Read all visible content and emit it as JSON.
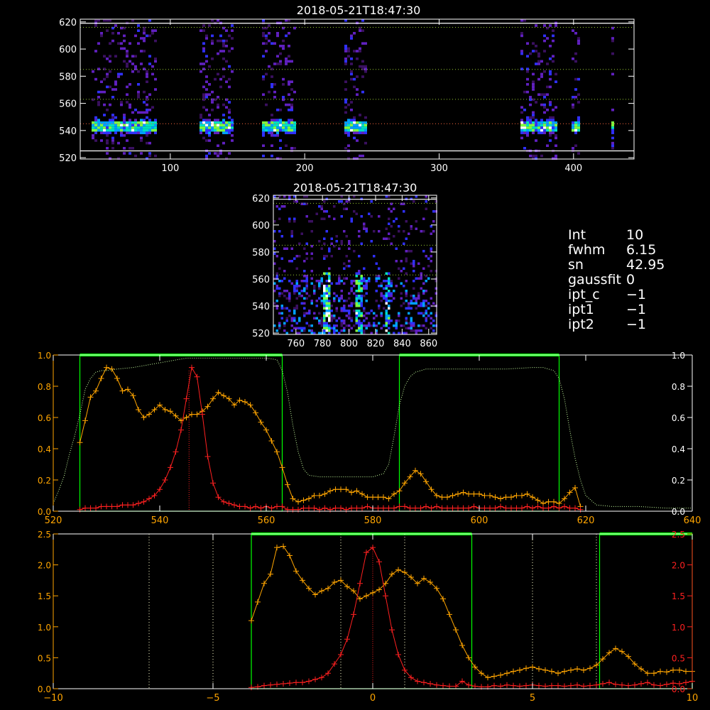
{
  "title_top": "2018-05-21T18:47:30",
  "title_mid": "2018-05-21T18:47:30",
  "info": [
    {
      "key": "Int",
      "value": "10"
    },
    {
      "key": "fwhm",
      "value": "6.15"
    },
    {
      "key": "sn",
      "value": "42.95"
    },
    {
      "key": "gaussfit",
      "value": "0"
    },
    {
      "key": "ipt_c",
      "value": "−1"
    },
    {
      "key": "ipt1",
      "value": "−1"
    },
    {
      "key": "ipt2",
      "value": "−1"
    }
  ],
  "colors": {
    "background": "#000000",
    "axes": "#ffffff",
    "orange": "#ffa500",
    "red": "#ff2020",
    "green": "#00ff00",
    "dotted_green": "#c8ffa0",
    "dotted_white": "#ffffcc"
  },
  "chart_data": [
    {
      "type": "heatmap",
      "title": "2018-05-21T18:47:30",
      "xlim": [
        33,
        445
      ],
      "ylim": [
        519,
        622
      ],
      "xticks": [
        100,
        200,
        300,
        400
      ],
      "yticks": [
        520,
        540,
        560,
        580,
        600,
        620
      ],
      "hlines_dotted": [
        545,
        563,
        585,
        616
      ],
      "hlines_solid": [
        525,
        619
      ],
      "active_columns": [
        [
          40,
          90
        ],
        [
          120,
          147
        ],
        [
          168,
          193
        ],
        [
          228,
          245
        ],
        [
          359,
          386
        ],
        [
          398,
          404
        ],
        [
          426,
          429
        ]
      ],
      "emission_row": 544
    },
    {
      "type": "heatmap",
      "title": "2018-05-21T18:47:30",
      "xlim": [
        743,
        866
      ],
      "ylim": [
        519,
        622
      ],
      "xticks": [
        760,
        780,
        800,
        820,
        840,
        860
      ],
      "yticks": [
        520,
        540,
        560,
        580,
        600,
        620
      ],
      "hlines_dotted": [
        563,
        585,
        616
      ],
      "hlines_solid": [
        619
      ],
      "bright_streaks": [
        782,
        807,
        828
      ]
    },
    {
      "type": "line",
      "xlim": [
        520,
        640
      ],
      "ylim": [
        0,
        1.0
      ],
      "xticks": [
        520,
        540,
        560,
        580,
        600,
        620,
        640
      ],
      "yticks_left": [
        "0.0",
        "0.2",
        "0.4",
        "0.6",
        "0.8",
        "1.0"
      ],
      "yticks_right": [
        "0.0",
        "0.2",
        "0.4",
        "0.6",
        "0.8",
        "1.0"
      ],
      "green_windows": [
        [
          525,
          563
        ],
        [
          585,
          615
        ]
      ],
      "center_line": 545.5,
      "series": [
        {
          "color": "orange",
          "x": [
            525,
            526,
            527,
            528,
            529,
            530,
            531,
            532,
            533,
            534,
            535,
            536,
            537,
            538,
            539,
            540,
            541,
            542,
            543,
            544,
            545,
            546,
            547,
            548,
            549,
            550,
            551,
            552,
            553,
            554,
            555,
            556,
            557,
            558,
            559,
            560,
            561,
            562,
            563,
            564,
            565,
            566,
            567,
            568,
            569,
            570,
            571,
            572,
            573,
            574,
            575,
            576,
            577,
            578,
            579,
            580,
            581,
            582,
            583,
            584,
            585,
            586,
            587,
            588,
            589,
            590,
            591,
            592,
            593,
            594,
            595,
            596,
            597,
            598,
            599,
            600,
            601,
            602,
            603,
            604,
            605,
            606,
            607,
            608,
            609,
            610,
            611,
            612,
            613,
            614,
            615,
            616,
            617,
            618,
            619
          ],
          "y": [
            0.44,
            0.58,
            0.73,
            0.77,
            0.85,
            0.92,
            0.91,
            0.85,
            0.77,
            0.78,
            0.74,
            0.65,
            0.6,
            0.62,
            0.65,
            0.68,
            0.65,
            0.64,
            0.61,
            0.58,
            0.6,
            0.62,
            0.62,
            0.64,
            0.67,
            0.72,
            0.76,
            0.74,
            0.72,
            0.68,
            0.71,
            0.7,
            0.68,
            0.63,
            0.57,
            0.52,
            0.45,
            0.38,
            0.28,
            0.17,
            0.08,
            0.06,
            0.07,
            0.08,
            0.1,
            0.1,
            0.11,
            0.13,
            0.14,
            0.14,
            0.14,
            0.12,
            0.13,
            0.11,
            0.09,
            0.09,
            0.09,
            0.09,
            0.08,
            0.11,
            0.13,
            0.18,
            0.22,
            0.26,
            0.24,
            0.19,
            0.14,
            0.1,
            0.09,
            0.09,
            0.1,
            0.11,
            0.12,
            0.11,
            0.11,
            0.11,
            0.1,
            0.1,
            0.09,
            0.08,
            0.09,
            0.09,
            0.1,
            0.1,
            0.11,
            0.09,
            0.07,
            0.05,
            0.06,
            0.06,
            0.05,
            0.08,
            0.12,
            0.15,
            0.03
          ]
        },
        {
          "color": "red",
          "x": [
            525,
            526,
            527,
            528,
            529,
            530,
            531,
            532,
            533,
            534,
            535,
            536,
            537,
            538,
            539,
            540,
            541,
            542,
            543,
            544,
            545,
            546,
            547,
            548,
            549,
            550,
            551,
            552,
            553,
            554,
            555,
            556,
            557,
            558,
            559,
            560,
            561,
            562,
            563,
            564,
            565,
            566,
            567,
            568,
            569,
            570,
            571,
            572,
            573,
            574,
            575,
            576,
            577,
            578,
            579,
            580,
            581,
            582,
            583,
            584,
            585,
            586,
            587,
            588,
            589,
            590,
            591,
            592,
            593,
            594,
            595,
            596,
            597,
            598,
            599,
            600,
            601,
            602,
            603,
            604,
            605,
            606,
            607,
            608,
            609,
            610,
            611,
            612,
            613,
            614,
            615,
            616,
            617,
            618,
            619
          ],
          "y": [
            0.01,
            0.02,
            0.02,
            0.02,
            0.03,
            0.03,
            0.03,
            0.03,
            0.04,
            0.04,
            0.04,
            0.05,
            0.06,
            0.08,
            0.1,
            0.14,
            0.2,
            0.28,
            0.38,
            0.52,
            0.72,
            0.92,
            0.86,
            0.62,
            0.35,
            0.18,
            0.09,
            0.06,
            0.05,
            0.04,
            0.03,
            0.03,
            0.02,
            0.03,
            0.02,
            0.03,
            0.02,
            0.03,
            0.03,
            0.01,
            0.01,
            0.01,
            0.02,
            0.02,
            0.02,
            0.01,
            0.02,
            0.01,
            0.02,
            0.02,
            0.01,
            0.02,
            0.02,
            0.02,
            0.03,
            0.02,
            0.02,
            0.02,
            0.02,
            0.02,
            0.03,
            0.03,
            0.02,
            0.02,
            0.02,
            0.03,
            0.02,
            0.03,
            0.02,
            0.02,
            0.02,
            0.02,
            0.02,
            0.02,
            0.03,
            0.02,
            0.02,
            0.02,
            0.02,
            0.03,
            0.02,
            0.02,
            0.02,
            0.02,
            0.03,
            0.02,
            0.03,
            0.02,
            0.02,
            0.03,
            0.02,
            0.03,
            0.02,
            0.02,
            0.01
          ]
        },
        {
          "color": "dotted_green",
          "x": [
            520,
            521,
            522,
            523,
            524,
            525,
            526,
            527,
            528,
            529,
            530,
            532,
            535,
            540,
            545,
            550,
            555,
            560,
            562,
            563,
            564,
            565,
            566,
            567,
            568,
            570,
            575,
            580,
            582,
            583,
            584,
            585,
            586,
            587,
            588,
            590,
            595,
            600,
            605,
            610,
            612,
            614,
            615,
            616,
            617,
            618,
            619,
            620,
            622,
            625,
            630,
            635,
            640
          ],
          "y": [
            0.05,
            0.13,
            0.22,
            0.36,
            0.48,
            0.62,
            0.78,
            0.85,
            0.89,
            0.9,
            0.9,
            0.91,
            0.92,
            0.95,
            0.98,
            0.98,
            0.98,
            0.98,
            0.97,
            0.9,
            0.76,
            0.55,
            0.38,
            0.27,
            0.23,
            0.22,
            0.22,
            0.22,
            0.24,
            0.3,
            0.48,
            0.68,
            0.8,
            0.86,
            0.89,
            0.91,
            0.91,
            0.91,
            0.91,
            0.92,
            0.92,
            0.9,
            0.85,
            0.72,
            0.52,
            0.34,
            0.2,
            0.1,
            0.04,
            0.03,
            0.03,
            0.02,
            0.02
          ]
        }
      ]
    },
    {
      "type": "line",
      "xlim": [
        -10,
        10
      ],
      "ylim": [
        0,
        2.5
      ],
      "xticks": [
        "−10",
        "−5",
        "0",
        "5",
        "10"
      ],
      "yticks_left": [
        "0.0",
        "0.5",
        "1.0",
        "1.5",
        "2.0",
        "2.5"
      ],
      "yticks_right": [
        "0.0",
        "0.5",
        "1.0",
        "1.5",
        "2.0",
        "2.5"
      ],
      "green_windows": [
        [
          -3.8,
          3.1
        ],
        [
          7.1,
          10
        ]
      ],
      "dotted_vlines": [
        -7,
        -5,
        -1,
        1,
        5,
        7
      ],
      "center_line": 0,
      "series": [
        {
          "color": "orange",
          "x": [
            -3.8,
            -3.6,
            -3.4,
            -3.2,
            -3.0,
            -2.8,
            -2.6,
            -2.4,
            -2.2,
            -2.0,
            -1.8,
            -1.6,
            -1.4,
            -1.2,
            -1.0,
            -0.8,
            -0.6,
            -0.4,
            -0.2,
            0.0,
            0.2,
            0.4,
            0.6,
            0.8,
            1.0,
            1.2,
            1.4,
            1.6,
            1.8,
            2.0,
            2.2,
            2.4,
            2.6,
            2.8,
            3.0,
            3.2,
            3.4,
            3.6,
            3.8,
            4.0,
            4.2,
            4.4,
            4.6,
            4.8,
            5.0,
            5.2,
            5.4,
            5.6,
            5.8,
            6.0,
            6.2,
            6.4,
            6.6,
            6.8,
            7.0,
            7.2,
            7.4,
            7.6,
            7.8,
            8.0,
            8.2,
            8.4,
            8.6,
            8.8,
            9.0,
            9.2,
            9.4,
            9.6,
            9.8,
            10.0
          ],
          "y": [
            1.1,
            1.4,
            1.7,
            1.85,
            2.28,
            2.3,
            2.15,
            1.9,
            1.75,
            1.62,
            1.52,
            1.58,
            1.62,
            1.72,
            1.75,
            1.65,
            1.58,
            1.45,
            1.5,
            1.55,
            1.6,
            1.7,
            1.85,
            1.92,
            1.88,
            1.8,
            1.7,
            1.78,
            1.72,
            1.62,
            1.45,
            1.2,
            0.95,
            0.7,
            0.5,
            0.35,
            0.25,
            0.18,
            0.2,
            0.22,
            0.25,
            0.28,
            0.3,
            0.33,
            0.35,
            0.32,
            0.3,
            0.28,
            0.25,
            0.28,
            0.3,
            0.32,
            0.3,
            0.33,
            0.38,
            0.48,
            0.58,
            0.65,
            0.6,
            0.52,
            0.4,
            0.32,
            0.25,
            0.25,
            0.28,
            0.27,
            0.3,
            0.3,
            0.28,
            0.28
          ]
        },
        {
          "color": "red",
          "x": [
            -3.8,
            -3.6,
            -3.4,
            -3.2,
            -3.0,
            -2.8,
            -2.6,
            -2.4,
            -2.2,
            -2.0,
            -1.8,
            -1.6,
            -1.4,
            -1.2,
            -1.0,
            -0.8,
            -0.6,
            -0.4,
            -0.2,
            0.0,
            0.2,
            0.4,
            0.6,
            0.8,
            1.0,
            1.2,
            1.4,
            1.6,
            1.8,
            2.0,
            2.2,
            2.4,
            2.6,
            2.8,
            3.0,
            3.2,
            3.4,
            3.6,
            3.8,
            4.0,
            4.2,
            4.4,
            4.6,
            4.8,
            5.0,
            5.2,
            5.4,
            5.6,
            5.8,
            6.0,
            6.2,
            6.4,
            6.6,
            6.8,
            7.0,
            7.2,
            7.4,
            7.6,
            7.8,
            8.0,
            8.2,
            8.4,
            8.6,
            8.8,
            9.0,
            9.2,
            9.4,
            9.6,
            9.8,
            10.0
          ],
          "y": [
            0.02,
            0.03,
            0.05,
            0.06,
            0.07,
            0.08,
            0.09,
            0.1,
            0.1,
            0.12,
            0.15,
            0.18,
            0.25,
            0.4,
            0.55,
            0.8,
            1.2,
            1.7,
            2.2,
            2.28,
            2.05,
            1.5,
            0.95,
            0.55,
            0.3,
            0.18,
            0.12,
            0.1,
            0.08,
            0.06,
            0.05,
            0.04,
            0.04,
            0.12,
            0.06,
            0.04,
            0.03,
            0.03,
            0.05,
            0.04,
            0.06,
            0.05,
            0.04,
            0.05,
            0.06,
            0.05,
            0.04,
            0.05,
            0.05,
            0.04,
            0.05,
            0.06,
            0.04,
            0.05,
            0.06,
            0.08,
            0.1,
            0.07,
            0.06,
            0.05,
            0.06,
            0.08,
            0.1,
            0.06,
            0.05,
            0.07,
            0.09,
            0.08,
            0.1,
            0.12
          ]
        }
      ]
    }
  ]
}
